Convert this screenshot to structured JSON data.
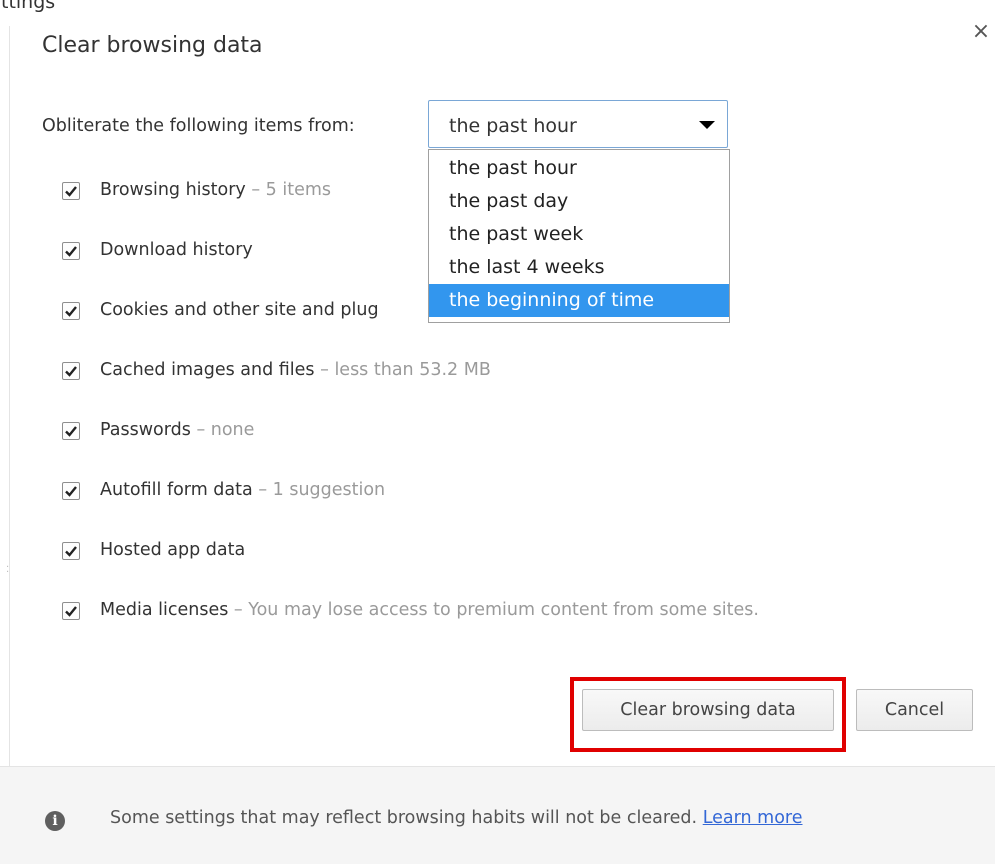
{
  "top_fragment": "ttings",
  "dialog": {
    "title": "Clear browsing data",
    "close_symbol": "×",
    "period_label": "Obliterate the following items from:",
    "period_selected": "the past hour",
    "period_options": [
      "the past hour",
      "the past day",
      "the past week",
      "the last 4 weeks",
      "the beginning of time"
    ],
    "period_highlighted_index": 4,
    "items": [
      {
        "label": "Browsing history",
        "detail": "–  5 items",
        "checked": true
      },
      {
        "label": "Download history",
        "detail": "",
        "checked": true
      },
      {
        "label": "Cookies and other site and plug",
        "detail": "",
        "checked": true
      },
      {
        "label": "Cached images and files",
        "detail": "–  less than 53.2 MB",
        "checked": true
      },
      {
        "label": "Passwords",
        "detail": "–  none",
        "checked": true
      },
      {
        "label": "Autofill form data",
        "detail": "–  1 suggestion",
        "checked": true
      },
      {
        "label": "Hosted app data",
        "detail": "",
        "checked": true
      },
      {
        "label": "Media licenses",
        "detail": "–  You may lose access to premium content from some sites.",
        "checked": true
      }
    ],
    "buttons": {
      "clear": "Clear browsing data",
      "cancel": "Cancel"
    },
    "footer": {
      "text": "Some settings that may reflect browsing habits will not be cleared.",
      "link": "Learn more"
    }
  },
  "colors": {
    "highlight_box": "#e00000",
    "dropdown_selected": "#3296ee",
    "link": "#3367d6"
  }
}
